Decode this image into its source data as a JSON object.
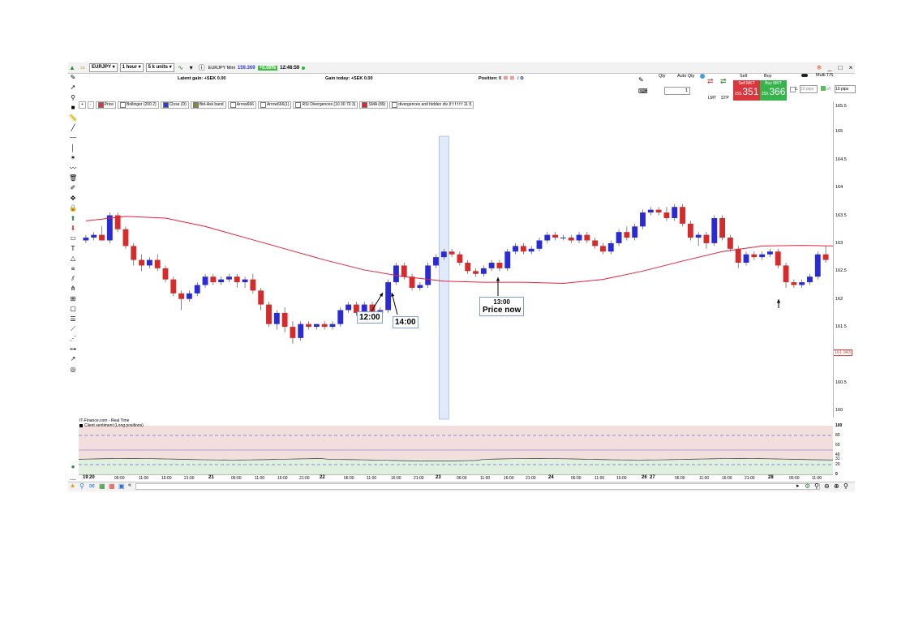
{
  "toolbar": {
    "instrument": "EURJPY",
    "interval": "1 hour",
    "units": "5 k units",
    "market_label": "EURJPY Mini",
    "price": "159.369",
    "change": "+0.08%",
    "time": "12:46:59"
  },
  "info": {
    "latent_gain": "Latent gain: +SEK 0.00",
    "gain_today": "Gain today: +SEK 0.00",
    "position": "Position: 0"
  },
  "order": {
    "qty_label": "Qty",
    "auto_qty_label": "Auto Qty",
    "qty_value": "1",
    "lmt": "LMT",
    "stp": "STP",
    "sell_label": "Sell",
    "buy_label": "Buy",
    "sell_mkt": "Sell MKT",
    "buy_mkt": "Buy MKT",
    "sell_small": "159.",
    "sell_big": "351",
    "buy_small": "159.",
    "buy_big": "366",
    "multi_tf": "Multi T/S",
    "l_label": "L",
    "pips1": "10",
    "pips_unit": "pips",
    "pips2": "10",
    "pips_unit2": "pips"
  },
  "legend": [
    {
      "label": "Price",
      "color": "#d9363e"
    },
    {
      "label": "Bollinger (200 2)",
      "color": "#ffffff"
    },
    {
      "label": "Close (D)",
      "color": "#2b3fd6"
    },
    {
      "label": "Bid-Ask band",
      "color": "#8a8a3a"
    },
    {
      "label": "Arrow666",
      "color": "#ffffff"
    },
    {
      "label": "Arrow666(1)",
      "color": "#ffffff"
    },
    {
      "label": "RSI Divergences (10 30 70 3)",
      "color": "#ffffff"
    },
    {
      "label": "SMA (89)",
      "color": "#e8203a"
    },
    {
      "label": "divergences and hidden div (f f f f f f 11 f)",
      "color": "#ffffff"
    }
  ],
  "y_axis": {
    "ticks": [
      "165.5",
      "165",
      "164.5",
      "164",
      "163.5",
      "163",
      "162.5",
      "162",
      "161.5",
      "161",
      "160.5",
      "160"
    ],
    "current": "161.043"
  },
  "annotations": {
    "a1": "12:00",
    "a2": "14:00",
    "a3_time": "13:00",
    "a3_text": "Price now"
  },
  "sentiment": {
    "source": "IT-Finance.com - Real Time",
    "title": "Client sentiment (Long positions)",
    "ticks": [
      "100",
      "80",
      "60",
      "40",
      "31",
      "20",
      "0"
    ]
  },
  "x_axis": {
    "labels": [
      {
        "t": "19",
        "bold": true
      },
      {
        "t": "20",
        "bold": true
      },
      {
        "t": "06:00"
      },
      {
        "t": "11:00"
      },
      {
        "t": "16:00"
      },
      {
        "t": "21:00"
      },
      {
        "t": "21",
        "bold": true
      },
      {
        "t": "06:00"
      },
      {
        "t": "11:00"
      },
      {
        "t": "16:00"
      },
      {
        "t": "21:00"
      },
      {
        "t": "22",
        "bold": true
      },
      {
        "t": "06:00"
      },
      {
        "t": "11:00"
      },
      {
        "t": "16:00"
      },
      {
        "t": "21:00"
      },
      {
        "t": "23",
        "bold": true
      },
      {
        "t": "06:00"
      },
      {
        "t": "11:00"
      },
      {
        "t": "16:00"
      },
      {
        "t": "21:00"
      },
      {
        "t": "24",
        "bold": true
      },
      {
        "t": "06:00"
      },
      {
        "t": "11:00"
      },
      {
        "t": "16:00"
      },
      {
        "t": "26",
        "bold": true
      },
      {
        "t": "27",
        "bold": true
      },
      {
        "t": "06:00"
      },
      {
        "t": "11:00"
      },
      {
        "t": "16:00"
      },
      {
        "t": "21:00"
      },
      {
        "t": "28",
        "bold": true
      },
      {
        "t": "06:00"
      },
      {
        "t": "11:00"
      }
    ]
  },
  "colors": {
    "bull": "#2b2bd6",
    "bear": "#d62b2b",
    "sma": "#e8203a",
    "highlight": "#c9d9f7",
    "sentiment_bg_top": "#f3dede",
    "sentiment_bg_bottom": "#dff0df"
  },
  "chart_data": {
    "type": "candlestick",
    "ylim": [
      159.8,
      165.5
    ],
    "candles": [
      [
        163.05,
        163.15,
        163.0,
        163.1
      ],
      [
        163.1,
        163.2,
        163.05,
        163.15
      ],
      [
        163.15,
        163.3,
        163.1,
        163.05
      ],
      [
        163.05,
        163.55,
        163.0,
        163.5
      ],
      [
        163.5,
        163.55,
        163.2,
        163.25
      ],
      [
        163.25,
        163.3,
        162.9,
        162.95
      ],
      [
        162.95,
        163.0,
        162.6,
        162.7
      ],
      [
        162.7,
        162.8,
        162.5,
        162.6
      ],
      [
        162.6,
        162.75,
        162.55,
        162.7
      ],
      [
        162.7,
        162.8,
        162.5,
        162.55
      ],
      [
        162.55,
        162.6,
        162.3,
        162.35
      ],
      [
        162.35,
        162.4,
        162.05,
        162.1
      ],
      [
        162.1,
        162.15,
        161.8,
        162.0
      ],
      [
        162.0,
        162.15,
        161.95,
        162.1
      ],
      [
        162.1,
        162.3,
        162.05,
        162.25
      ],
      [
        162.25,
        162.45,
        162.2,
        162.4
      ],
      [
        162.4,
        162.45,
        162.25,
        162.3
      ],
      [
        162.3,
        162.4,
        162.25,
        162.35
      ],
      [
        162.35,
        162.45,
        162.3,
        162.4
      ],
      [
        162.4,
        162.45,
        162.2,
        162.3
      ],
      [
        162.3,
        162.4,
        162.2,
        162.35
      ],
      [
        162.35,
        162.45,
        162.1,
        162.15
      ],
      [
        162.15,
        162.2,
        161.8,
        161.9
      ],
      [
        161.9,
        161.95,
        161.5,
        161.55
      ],
      [
        161.55,
        161.8,
        161.45,
        161.75
      ],
      [
        161.75,
        161.85,
        161.4,
        161.5
      ],
      [
        161.5,
        161.6,
        161.2,
        161.3
      ],
      [
        161.3,
        161.6,
        161.25,
        161.55
      ],
      [
        161.55,
        161.6,
        161.45,
        161.5
      ],
      [
        161.5,
        161.55,
        161.45,
        161.55
      ],
      [
        161.55,
        161.6,
        161.45,
        161.5
      ],
      [
        161.5,
        161.6,
        161.45,
        161.55
      ],
      [
        161.55,
        161.85,
        161.5,
        161.8
      ],
      [
        161.8,
        161.95,
        161.75,
        161.9
      ],
      [
        161.9,
        161.95,
        161.7,
        161.75
      ],
      [
        161.75,
        161.95,
        161.7,
        161.9
      ],
      [
        161.9,
        161.95,
        161.7,
        161.75
      ],
      [
        161.75,
        161.85,
        161.65,
        161.8
      ],
      [
        161.8,
        162.35,
        161.75,
        162.3
      ],
      [
        162.3,
        162.65,
        162.25,
        162.6
      ],
      [
        162.6,
        162.65,
        162.35,
        162.4
      ],
      [
        162.4,
        162.45,
        162.15,
        162.2
      ],
      [
        162.2,
        162.3,
        162.15,
        162.25
      ],
      [
        162.25,
        162.65,
        162.2,
        162.6
      ],
      [
        162.6,
        162.8,
        162.55,
        162.75
      ],
      [
        162.75,
        162.9,
        162.7,
        162.85
      ],
      [
        162.85,
        162.9,
        162.75,
        162.8
      ],
      [
        162.8,
        162.85,
        162.6,
        162.65
      ],
      [
        162.65,
        162.7,
        162.45,
        162.5
      ],
      [
        162.5,
        162.55,
        162.4,
        162.45
      ],
      [
        162.45,
        162.6,
        162.4,
        162.55
      ],
      [
        162.55,
        162.7,
        162.5,
        162.65
      ],
      [
        162.65,
        162.7,
        162.5,
        162.55
      ],
      [
        162.55,
        162.9,
        162.5,
        162.85
      ],
      [
        162.85,
        163.0,
        162.8,
        162.95
      ],
      [
        162.95,
        163.0,
        162.8,
        162.85
      ],
      [
        162.85,
        162.95,
        162.8,
        162.9
      ],
      [
        162.9,
        163.1,
        162.85,
        163.05
      ],
      [
        163.05,
        163.2,
        163.0,
        163.15
      ],
      [
        163.15,
        163.2,
        163.05,
        163.1
      ],
      [
        163.1,
        163.15,
        163.05,
        163.1
      ],
      [
        163.1,
        163.15,
        163.0,
        163.05
      ],
      [
        163.05,
        163.2,
        163.0,
        163.15
      ],
      [
        163.15,
        163.2,
        163.0,
        163.05
      ],
      [
        163.05,
        163.1,
        162.9,
        162.95
      ],
      [
        162.95,
        163.0,
        162.8,
        162.85
      ],
      [
        162.85,
        163.05,
        162.8,
        163.0
      ],
      [
        163.0,
        163.25,
        162.95,
        163.2
      ],
      [
        163.2,
        163.3,
        163.05,
        163.1
      ],
      [
        163.1,
        163.35,
        163.05,
        163.3
      ],
      [
        163.3,
        163.6,
        163.25,
        163.55
      ],
      [
        163.55,
        163.65,
        163.5,
        163.6
      ],
      [
        163.6,
        163.65,
        163.5,
        163.55
      ],
      [
        163.55,
        163.65,
        163.4,
        163.45
      ],
      [
        163.45,
        163.7,
        163.4,
        163.65
      ],
      [
        163.65,
        163.7,
        163.3,
        163.35
      ],
      [
        163.35,
        163.4,
        163.05,
        163.1
      ],
      [
        163.1,
        163.2,
        162.95,
        163.15
      ],
      [
        163.15,
        163.2,
        162.9,
        163.0
      ],
      [
        163.0,
        163.5,
        162.95,
        163.45
      ],
      [
        163.45,
        163.5,
        163.05,
        163.1
      ],
      [
        163.1,
        163.15,
        162.85,
        162.9
      ],
      [
        162.9,
        162.95,
        162.55,
        162.65
      ],
      [
        162.65,
        162.85,
        162.6,
        162.8
      ],
      [
        162.8,
        162.85,
        162.7,
        162.75
      ],
      [
        162.75,
        162.85,
        162.7,
        162.8
      ],
      [
        162.8,
        162.9,
        162.75,
        162.85
      ],
      [
        162.85,
        162.9,
        162.55,
        162.6
      ],
      [
        162.6,
        162.65,
        162.2,
        162.3
      ],
      [
        162.3,
        162.35,
        162.2,
        162.25
      ],
      [
        162.25,
        162.35,
        162.2,
        162.3
      ],
      [
        162.3,
        162.45,
        162.25,
        162.4
      ],
      [
        162.4,
        162.85,
        162.35,
        162.8
      ],
      [
        162.8,
        162.95,
        162.65,
        162.7
      ]
    ],
    "sma": [
      [
        0,
        163.4
      ],
      [
        5,
        163.48
      ],
      [
        10,
        163.45
      ],
      [
        15,
        163.3
      ],
      [
        20,
        163.1
      ],
      [
        25,
        162.9
      ],
      [
        30,
        162.7
      ],
      [
        35,
        162.52
      ],
      [
        40,
        162.4
      ],
      [
        45,
        162.32
      ],
      [
        50,
        162.3
      ],
      [
        55,
        162.3
      ],
      [
        60,
        162.28
      ],
      [
        65,
        162.35
      ],
      [
        70,
        162.5
      ],
      [
        75,
        162.68
      ],
      [
        80,
        162.85
      ],
      [
        85,
        162.95
      ],
      [
        90,
        162.96
      ],
      [
        94,
        162.95
      ]
    ],
    "highlight_index": 45
  }
}
